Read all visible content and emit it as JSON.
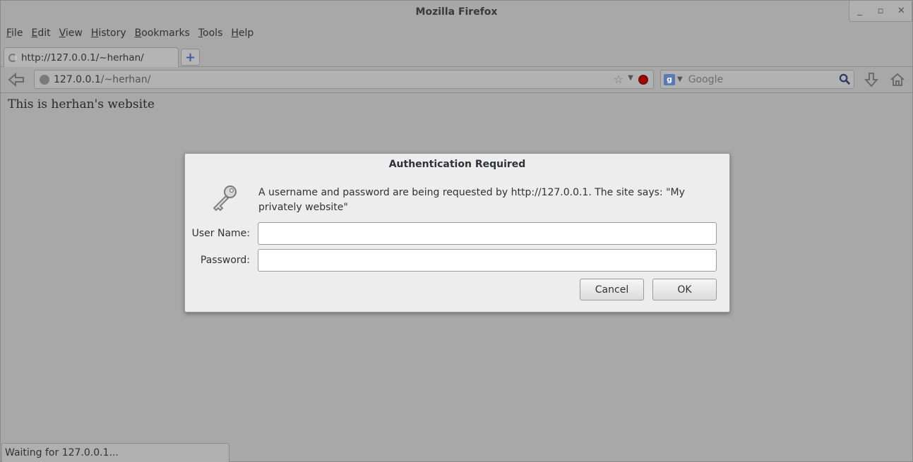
{
  "window": {
    "title": "Mozilla Firefox",
    "controls": {
      "minimize": "_",
      "maximize": "▫",
      "close": "✕"
    }
  },
  "menu": [
    "File",
    "Edit",
    "View",
    "History",
    "Bookmarks",
    "Tools",
    "Help"
  ],
  "tabs": [
    {
      "label": "http://127.0.0.1/~herhan/",
      "loading": true
    }
  ],
  "nav": {
    "url_host": "127.0.0.1",
    "url_path": "/~herhan/",
    "search_placeholder": "Google",
    "search_engine_badge": "g",
    "icons": [
      "back-icon",
      "site-identity-icon",
      "bookmark-star-icon",
      "stop-icon",
      "search-engine-icon",
      "search-go-icon",
      "download-icon",
      "home-icon"
    ]
  },
  "page": {
    "text": "This is herhan's website"
  },
  "status": {
    "text": "Waiting for 127.0.0.1..."
  },
  "dialog": {
    "title": "Authentication Required",
    "message": "A username and password are being requested by http://127.0.0.1. The site says: \"My privately website\"",
    "username_label": "User Name:",
    "password_label": "Password:",
    "username_value": "",
    "password_value": "",
    "cancel_label": "Cancel",
    "ok_label": "OK"
  },
  "colors": {
    "stop_button": "#aa0000",
    "search_engine_badge": "#5a7ab6",
    "new_tab_plus": "#3e5e9a"
  }
}
